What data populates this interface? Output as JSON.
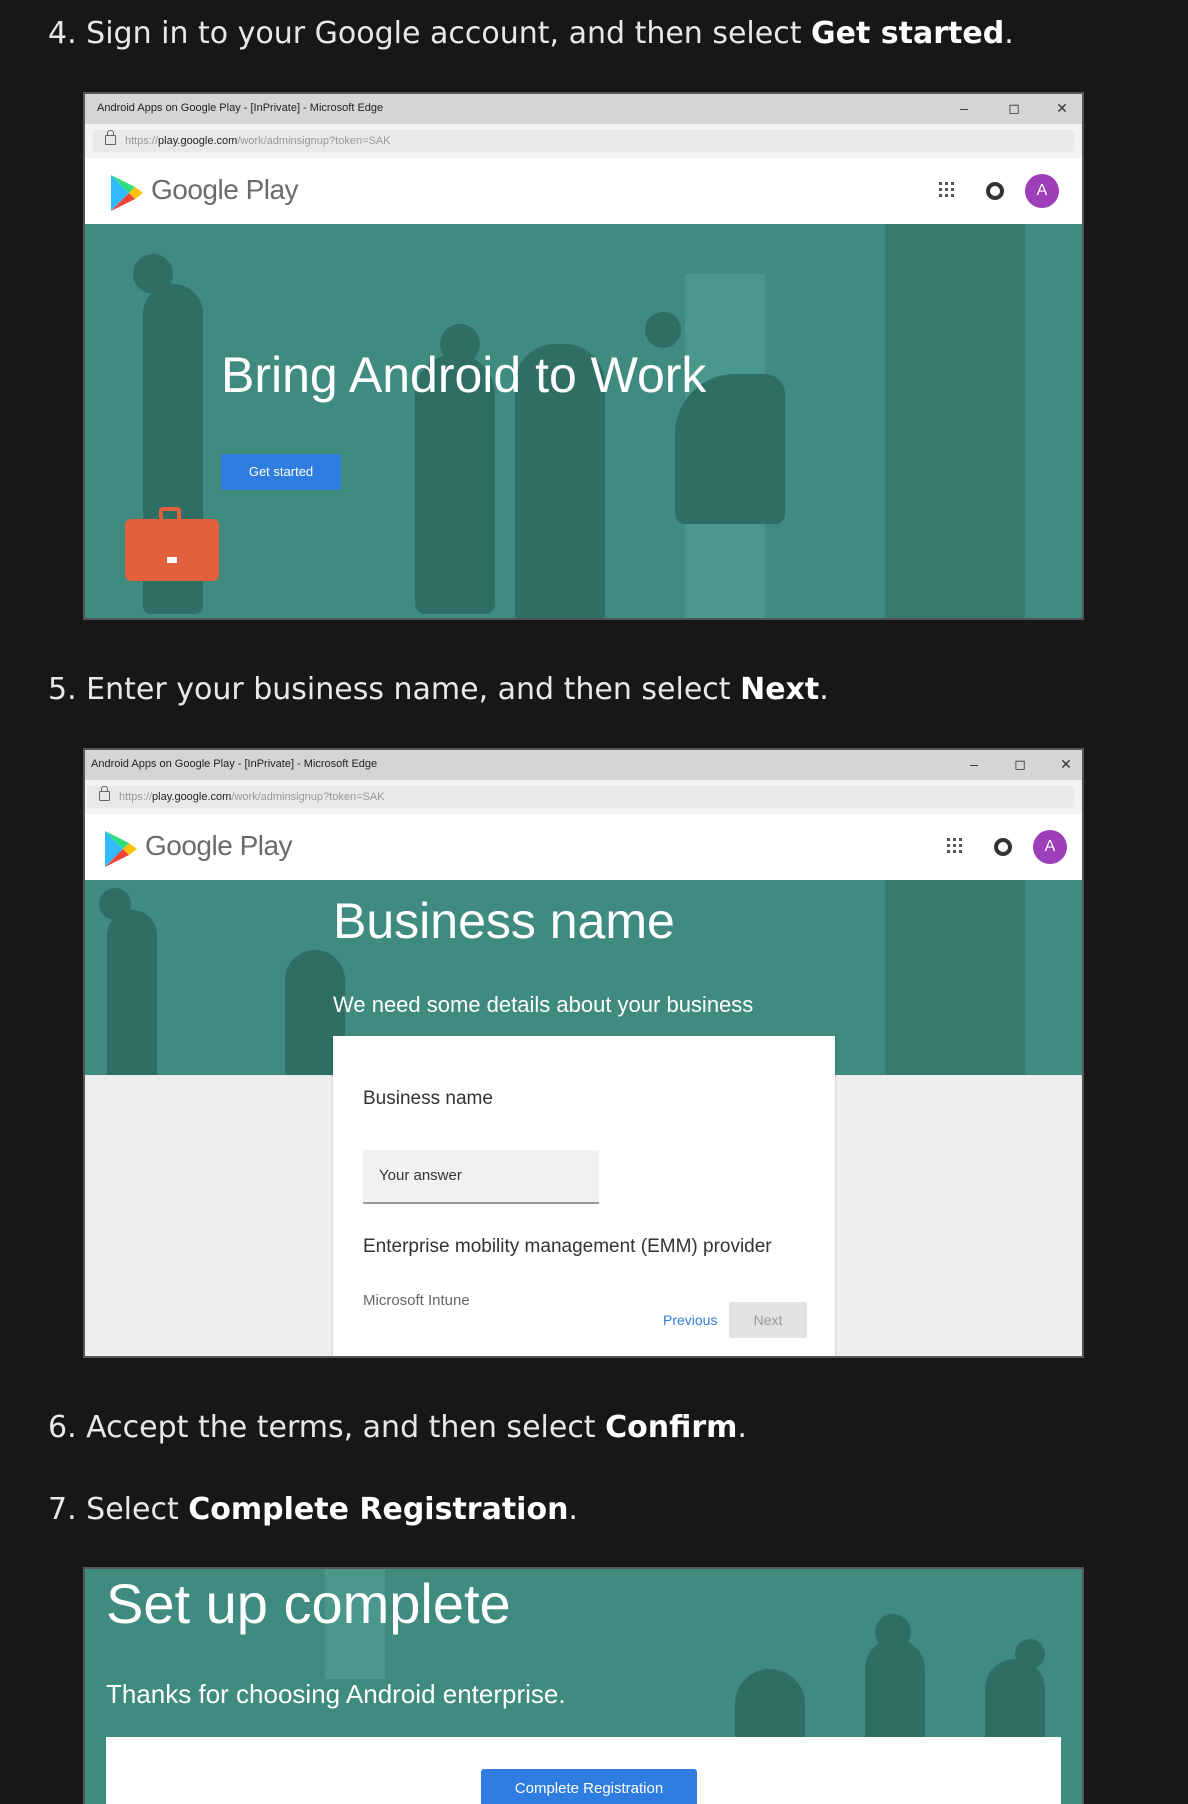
{
  "steps": [
    {
      "number": "4.",
      "text_before": "Sign in to your Google account, and then select ",
      "bold": "Get started",
      "text_after": "."
    },
    {
      "number": "5.",
      "text_before": "Enter your business name, and then select ",
      "bold": "Next",
      "text_after": "."
    },
    {
      "number": "6.",
      "text_before": "Accept the terms, and then select ",
      "bold": "Confirm",
      "text_after": "."
    },
    {
      "number": "7.",
      "text_before": "Select ",
      "bold": "Complete Registration",
      "text_after": "."
    }
  ],
  "browser": {
    "window_title": "Android Apps on Google Play - [InPrivate] - Microsoft Edge",
    "url_scheme": "https://",
    "url_domain": "play.google.com",
    "url_path": "/work/adminsignup?token=SAK",
    "minimize": "–",
    "maximize": "◻",
    "close": "✕",
    "brand": "Google Play",
    "avatar_letter": "A"
  },
  "shot1": {
    "hero_title": "Bring Android to Work",
    "get_started": "Get started"
  },
  "shot2": {
    "title": "Business name",
    "subtitle": "We need some details about your business",
    "field_label": "Business name",
    "field_placeholder": "Your answer",
    "emm_label": "Enterprise mobility management (EMM) provider",
    "emm_value": "Microsoft Intune",
    "previous": "Previous",
    "next": "Next"
  },
  "shot3": {
    "title": "Set up complete",
    "subtitle": "Thanks for choosing Android enterprise.",
    "complete_button": "Complete Registration"
  },
  "colors": {
    "page_bg": "#171717",
    "teal": "#3f8b80",
    "button_blue": "#2f7de1",
    "avatar_purple": "#9c3fb8",
    "briefcase_orange": "#e2603c"
  }
}
